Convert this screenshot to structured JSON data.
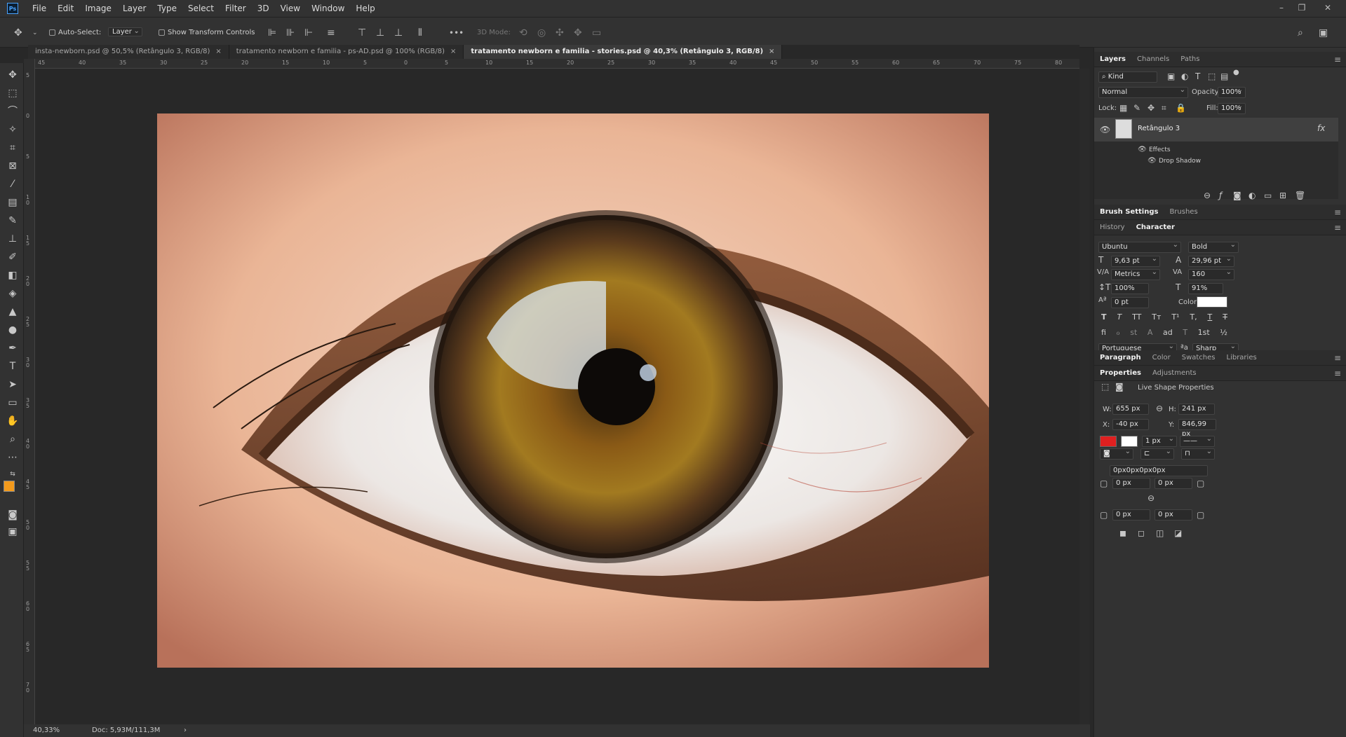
{
  "app": {
    "logo": "Ps"
  },
  "menu": [
    "File",
    "Edit",
    "Image",
    "Layer",
    "Type",
    "Select",
    "Filter",
    "3D",
    "View",
    "Window",
    "Help"
  ],
  "options": {
    "auto_select_label": "Auto-Select:",
    "auto_select_value": "Layer",
    "show_transform_label": "Show Transform Controls",
    "three_d_mode_label": "3D Mode:",
    "more": "•••"
  },
  "tabs": [
    {
      "label": "insta-newborn.psd @ 50,5% (Retângulo 3, RGB/8)",
      "close": "×"
    },
    {
      "label": "tratamento newborn e familia - ps-AD.psd @ 100% (RGB/8)",
      "close": "×"
    },
    {
      "label": "tratamento newborn e familia - stories.psd @ 40,3% (Retângulo 3, RGB/8)",
      "close": "×"
    }
  ],
  "hruler_ticks": [
    "45",
    "40",
    "35",
    "30",
    "25",
    "20",
    "15",
    "10",
    "5",
    "0",
    "5",
    "10",
    "15",
    "20",
    "25",
    "30",
    "35",
    "40",
    "45",
    "50",
    "55",
    "60",
    "65",
    "70",
    "75",
    "80"
  ],
  "vruler_ticks": [
    "5",
    "0",
    "5",
    "1 0",
    "1 5",
    "2 0",
    "2 5",
    "3 0",
    "3 5",
    "4 0",
    "4 5",
    "5 0",
    "5 5",
    "6 0",
    "6 5",
    "7 0"
  ],
  "status": {
    "zoom": "40,33%",
    "doc": "Doc: 5,93M/111,3M",
    "arrow": "›"
  },
  "layers_panel": {
    "tabs": [
      "Layers",
      "Channels",
      "Paths"
    ],
    "kind": "Kind",
    "blend_mode": "Normal",
    "opacity_label": "Opacity:",
    "opacity_value": "100%",
    "lock_label": "Lock:",
    "fill_label": "Fill:",
    "fill_value": "100%",
    "layer_name": "Retângulo 3",
    "fx": "fx",
    "effects_label": "Effects",
    "drop_shadow_label": "Drop Shadow"
  },
  "brush_tabs": [
    "Brush Settings",
    "Brushes"
  ],
  "character_panel": {
    "tabs": [
      "History",
      "Character"
    ],
    "font_family": "Ubuntu",
    "font_style": "Bold",
    "font_size": "9,63 pt",
    "leading": "29,96 pt",
    "kerning": "Metrics",
    "tracking": "160",
    "vscale": "100%",
    "hscale": "91%",
    "baseline": "0 pt",
    "color_label": "Color:",
    "color_value": "#ffffff",
    "type_buttons": [
      "T",
      "T",
      "TT",
      "Tт",
      "T¹",
      "T,",
      "T",
      "T"
    ],
    "ot_buttons": [
      "ﬁ",
      "ℴ",
      "st",
      "A",
      "ad",
      "T",
      "1st",
      "½"
    ],
    "language": "Portuguese",
    "aa_label": "ªa",
    "antialias": "Sharp"
  },
  "paragraph_tabs": [
    "Paragraph",
    "Color",
    "Swatches",
    "Libraries"
  ],
  "properties_panel": {
    "tabs": [
      "Properties",
      "Adjustments"
    ],
    "title": "Live Shape Properties",
    "w_label": "W:",
    "w_value": "655 px",
    "h_label": "H:",
    "h_value": "241 px",
    "x_label": "X:",
    "x_value": "-40 px",
    "y_label": "Y:",
    "y_value": "846,99 px",
    "fill_color": "#e02020",
    "stroke_width": "1 px",
    "corner_all": "0px0px0px0px",
    "corner_tl": "0 px",
    "corner_tr": "0 px",
    "corner_bl": "0 px",
    "corner_br": "0 px"
  },
  "colors": {
    "foreground": "#f39a1c",
    "background": "#ffffff"
  }
}
